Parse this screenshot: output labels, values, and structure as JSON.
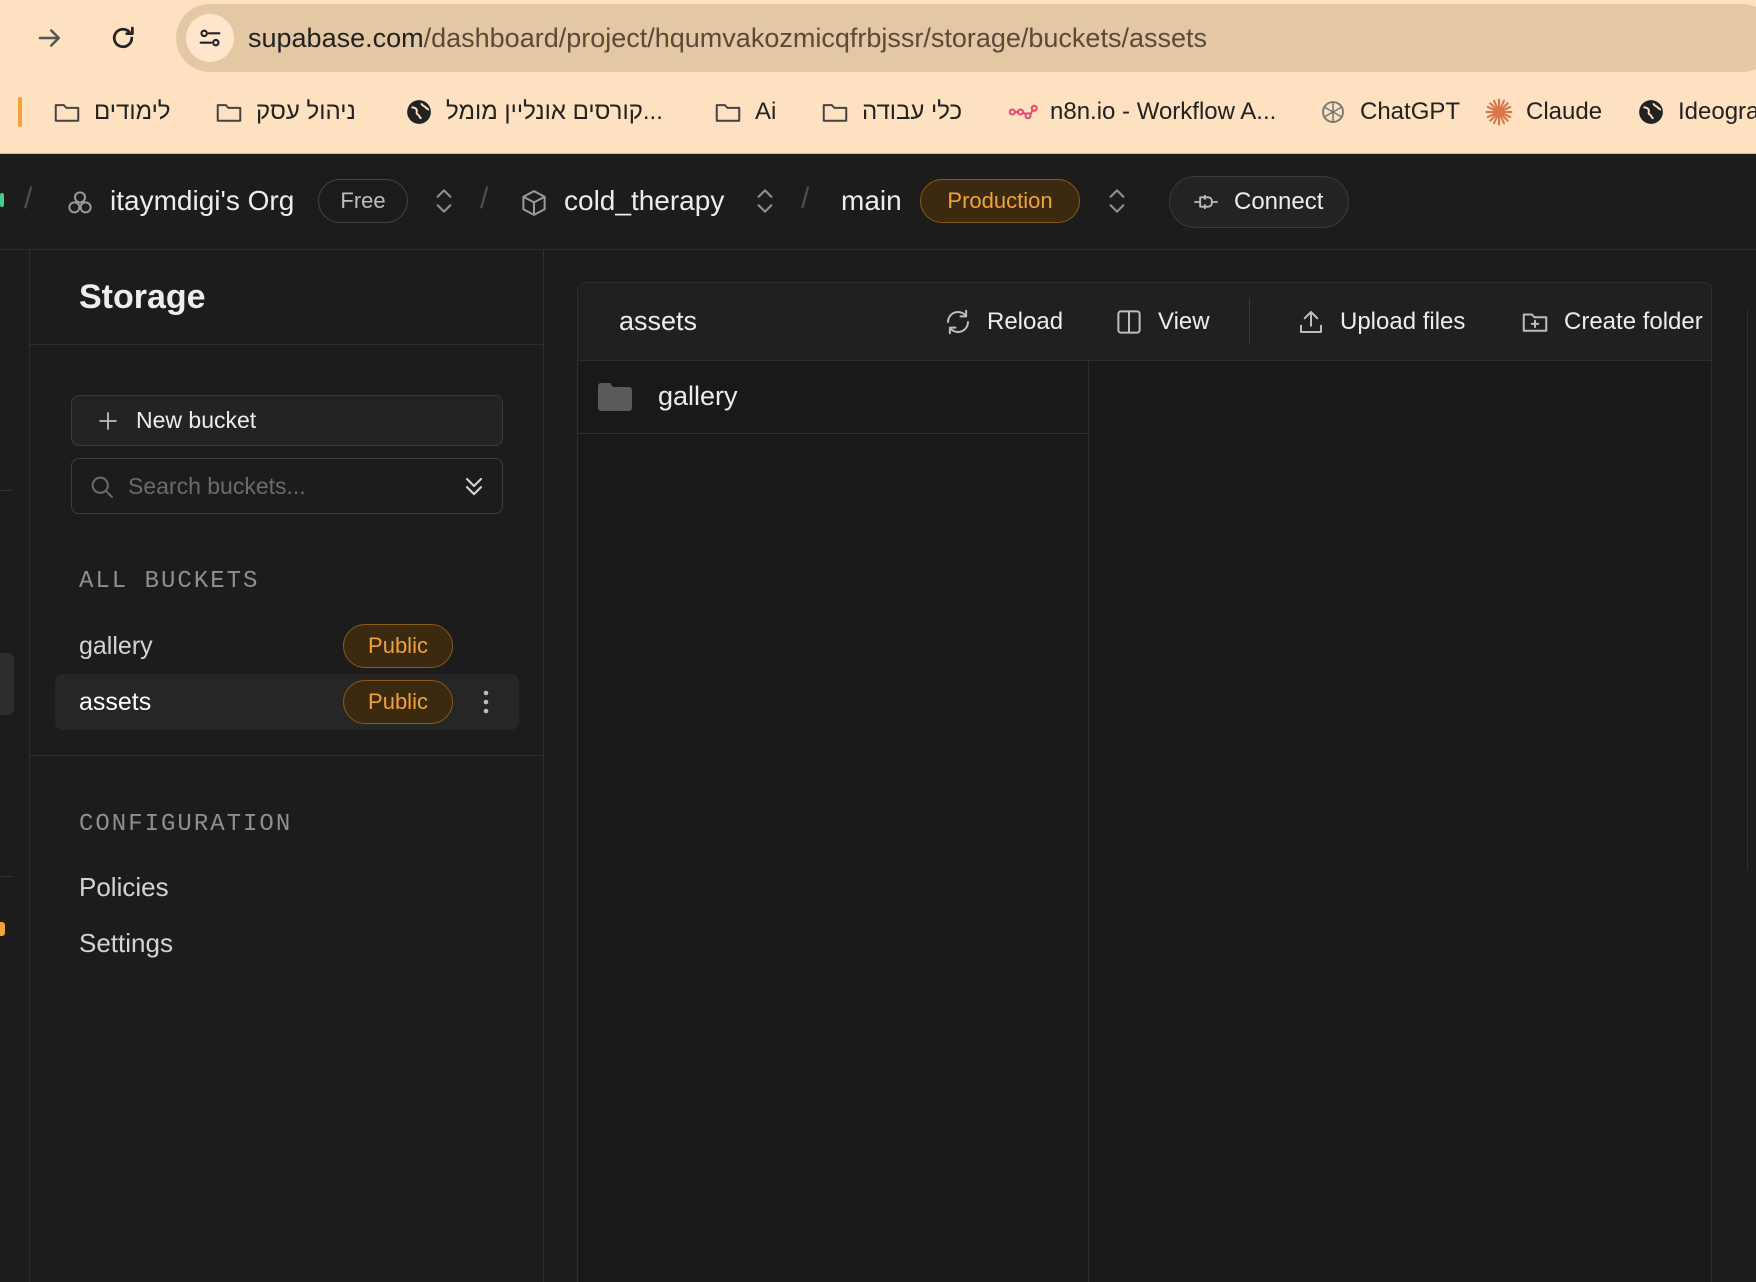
{
  "browser": {
    "url_host": "supabase.com",
    "url_path": "/dashboard/project/hqumvakozmicqfrbjssr/storage/buckets/assets",
    "bookmarks": [
      {
        "label": "לימודים",
        "icon": "folder-icon"
      },
      {
        "label": "ניהול עסק",
        "icon": "folder-icon"
      },
      {
        "label": "קורסים אונליין מומל...",
        "icon": "globe-icon"
      },
      {
        "label": "Ai",
        "icon": "folder-icon"
      },
      {
        "label": "כלי עבודה",
        "icon": "folder-icon"
      },
      {
        "label": "n8n.io - Workflow A...",
        "icon": "n8n-icon"
      },
      {
        "label": "ChatGPT",
        "icon": "chatgpt-icon"
      },
      {
        "label": "Claude",
        "icon": "claude-icon"
      },
      {
        "label": "Ideogra",
        "icon": "globe-icon"
      }
    ]
  },
  "topbar": {
    "org": "itaymdigi's Org",
    "plan": "Free",
    "project": "cold_therapy",
    "branch": "main",
    "env": "Production",
    "connect": "Connect"
  },
  "sidebar": {
    "title": "Storage",
    "new_bucket": "New bucket",
    "search_placeholder": "Search buckets...",
    "buckets_label": "ALL BUCKETS",
    "buckets": [
      {
        "name": "gallery",
        "badge": "Public"
      },
      {
        "name": "assets",
        "badge": "Public"
      }
    ],
    "config_label": "CONFIGURATION",
    "config_items": [
      "Policies",
      "Settings"
    ]
  },
  "explorer": {
    "bucket": "assets",
    "reload": "Reload",
    "view": "View",
    "upload": "Upload files",
    "create_folder": "Create folder",
    "items": [
      {
        "name": "gallery",
        "type": "folder"
      }
    ]
  },
  "colors": {
    "accent_orange": "#f2a13b",
    "brand_green": "#3ecf8e",
    "chrome_bg": "#fde1c1",
    "app_bg": "#1c1c1c"
  }
}
